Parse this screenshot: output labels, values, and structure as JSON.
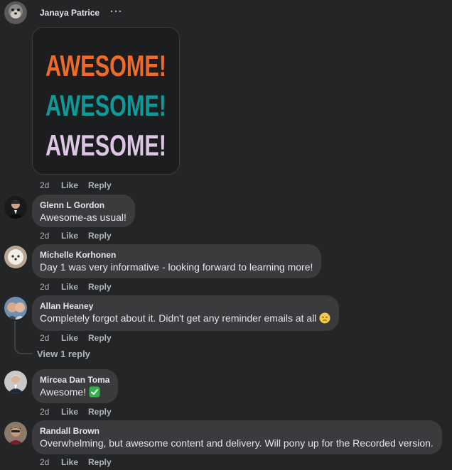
{
  "post": {
    "author": "Janaya Patrice",
    "more_options_icon": "ellipsis-icon",
    "sticker": {
      "lines": [
        "AWESOME!",
        "AWESOME!",
        "AWESOME!"
      ],
      "colors": [
        "#f06a2a",
        "#0e9a98",
        "#dcc6e4"
      ]
    },
    "time": "2d",
    "like_label": "Like",
    "reply_label": "Reply"
  },
  "comments": [
    {
      "author": "Glenn L Gordon",
      "text": "Awesome-as usual!",
      "time": "2d",
      "like_label": "Like",
      "reply_label": "Reply"
    },
    {
      "author": "Michelle Korhonen",
      "text": "Day 1 was very informative - looking forward to learning more!",
      "time": "2d",
      "like_label": "Like",
      "reply_label": "Reply"
    },
    {
      "author": "Allan Heaney",
      "text": "Completely forgot about it. Didn't get any reminder emails at all",
      "emoji": "pensive-face-icon",
      "time": "2d",
      "like_label": "Like",
      "reply_label": "Reply",
      "view_replies_label": "View 1 reply"
    },
    {
      "author": "Mircea Dan Toma",
      "text": "Awesome!",
      "emoji": "check-mark-button-icon",
      "time": "2d",
      "like_label": "Like",
      "reply_label": "Reply"
    },
    {
      "author": "Randall Brown",
      "text": "Overwhelming, but awesome content and delivery. Will pony up for the Recorded version.",
      "time": "2d",
      "like_label": "Like",
      "reply_label": "Reply"
    }
  ],
  "colors": {
    "background": "#242526",
    "bubble": "#3a3b3c",
    "primary_text": "#e4e6eb",
    "secondary_text": "#b0b3b8"
  }
}
